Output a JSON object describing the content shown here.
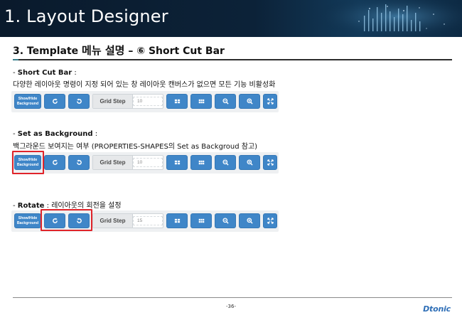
{
  "colors": {
    "banner_bg": "#0c2238",
    "button_blue": "#3f86c8",
    "highlight_red": "#e0242a",
    "logo_blue": "#2f6fb7"
  },
  "banner": {
    "title": "1. Layout Designer"
  },
  "heading": {
    "prefix": "3.  Template ",
    "korean": "메뉴 설명",
    "suffix": " – ⑥ Short Cut Bar"
  },
  "sections": [
    {
      "dash": "- ",
      "title": "Short Cut Bar",
      "colon": " :",
      "description": "다양한 레이아웃 명령이 지정 되어 있는 창 레이아웃 캔버스가 없으면 모든 기능 비활성화",
      "grid_value": "10"
    },
    {
      "dash": "- ",
      "title": "Set as Background",
      "colon": " :",
      "description": "백그라운드 보여지는 여부 (PROPERTIES-SHAPES의  Set as Backgroud 참고)",
      "grid_value": "10"
    },
    {
      "dash": "- ",
      "title": "Rotate",
      "colon": " : 레이아웃의 회전을 설정",
      "description": "",
      "grid_value": "15"
    }
  ],
  "toolbar": {
    "show_hide_line1": "Show/Hide",
    "show_hide_line2": "Background",
    "grid_step_label": "Grid Step",
    "icons": [
      "rotate-right-icon",
      "rotate-left-icon",
      "grid-small-icon",
      "grid-large-icon",
      "zoom-out-icon",
      "zoom-in-icon",
      "fit-screen-icon"
    ]
  },
  "footer": {
    "page_number": "-36-",
    "logo": "Dtonic"
  }
}
